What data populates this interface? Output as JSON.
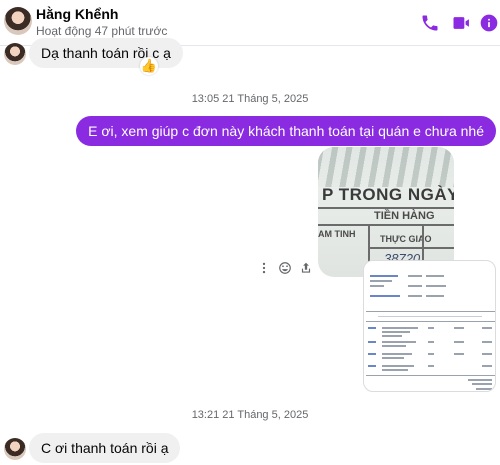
{
  "header": {
    "contact_name": "Hằng Khểnh",
    "status": "Hoạt động 47 phút trước",
    "icons": [
      "phone-icon",
      "video-camera-icon",
      "info-icon"
    ],
    "accent_color": "#8a2be2"
  },
  "messages": [
    {
      "direction": "incoming",
      "text": "Dạ thanh toán rồi c ạ",
      "reaction": "👍"
    },
    {
      "type": "timestamp",
      "text": "13:05 21 Tháng 5, 2025"
    },
    {
      "direction": "outgoing",
      "text": "E ơi, xem giúp c đơn này  khách thanh toán tại quán e chưa nhé"
    },
    {
      "direction": "outgoing",
      "type": "photo",
      "visible_text": [
        "P TRONG NGÀY ..",
        "TIỀN HÀNG",
        "AM TINH",
        "THỰC GIAO",
        "38720"
      ]
    },
    {
      "direction": "outgoing",
      "type": "photo",
      "description_icon": "invoice-image"
    },
    {
      "type": "timestamp",
      "text": "13:21 21 Tháng 5, 2025"
    },
    {
      "direction": "incoming",
      "text": "C ơi thanh toán rồi ạ"
    }
  ],
  "message_actions": [
    "more-options-icon",
    "react-icon",
    "share-icon"
  ]
}
